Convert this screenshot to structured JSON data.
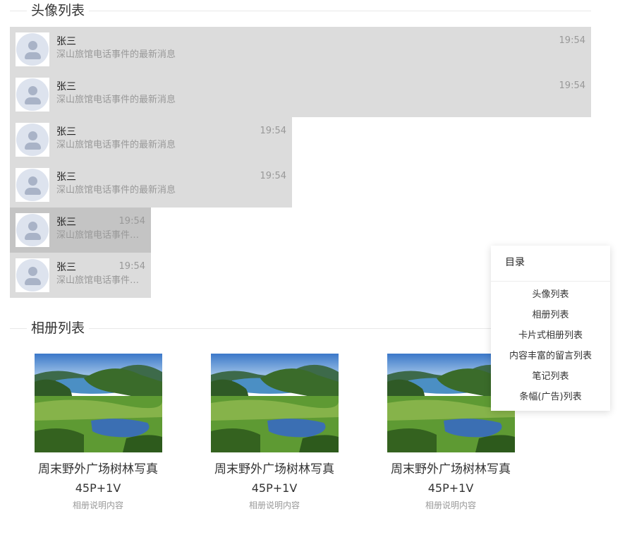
{
  "sections": {
    "avatar_list_title": "头像列表",
    "album_list_title": "相册列表"
  },
  "avatar_items": [
    {
      "name": "张三",
      "message": "深山旅馆电话事件的最新消息",
      "time": "19:54"
    },
    {
      "name": "张三",
      "message": "深山旅馆电话事件的最新消息",
      "time": "19:54"
    },
    {
      "name": "张三",
      "message": "深山旅馆电话事件的最新消息",
      "time": "19:54"
    },
    {
      "name": "张三",
      "message": "深山旅馆电话事件的最新消息",
      "time": "19:54"
    },
    {
      "name": "张三",
      "message": "深山旅馆电话事件的最新消息",
      "time": "19:54"
    },
    {
      "name": "张三",
      "message": "深山旅馆电话事件的最新消息",
      "time": "19:54"
    }
  ],
  "album_items": [
    {
      "title": "周末野外广场树林写真",
      "count": "45P+1V",
      "description": "相册说明内容"
    },
    {
      "title": "周末野外广场树林写真",
      "count": "45P+1V",
      "description": "相册说明内容"
    },
    {
      "title": "周末野外广场树林写真",
      "count": "45P+1V",
      "description": "相册说明内容"
    }
  ],
  "toc": {
    "title": "目录",
    "items": [
      "头像列表",
      "相册列表",
      "卡片式相册列表",
      "内容丰富的留言列表",
      "笔记列表",
      "条幅(广告)列表"
    ]
  },
  "icons": {
    "avatar": "user-avatar-icon"
  },
  "colors": {
    "item_background": "#dcdcdc",
    "item_active_background": "#c4c4c4",
    "avatar_bg": "#dde3ee",
    "avatar_fg": "#a9b3c7"
  }
}
